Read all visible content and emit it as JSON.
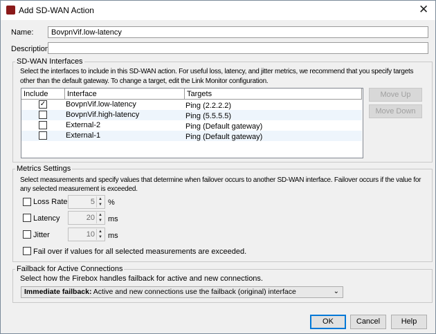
{
  "window": {
    "title": "Add SD-WAN Action"
  },
  "form": {
    "name_label": "Name:",
    "name_value": "BovpnVif.low-latency",
    "description_label": "Description:",
    "description_value": ""
  },
  "interfaces": {
    "legend": "SD-WAN Interfaces",
    "help_line1": "Select the interfaces to include in this SD-WAN action. For useful loss, latency, and jitter metrics, we recommend that you specify targets",
    "help_line2": "other than the default gateway. To change a target, edit the Link Monitor configuration.",
    "columns": [
      "Include",
      "Interface",
      "Targets"
    ],
    "rows": [
      {
        "include": true,
        "interface": "BovpnVif.low-latency",
        "target": "Ping (2.2.2.2)"
      },
      {
        "include": false,
        "interface": "BovpnVif.high-latency",
        "target": "Ping (5.5.5.5)"
      },
      {
        "include": false,
        "interface": "External-2",
        "target": "Ping (Default gateway)"
      },
      {
        "include": false,
        "interface": "External-1",
        "target": "Ping (Default gateway)"
      }
    ],
    "move_up": "Move Up",
    "move_down": "Move Down"
  },
  "metrics": {
    "legend": "Metrics Settings",
    "help_line1": "Select measurements and specify values that determine when failover occurs to another SD-WAN interface. Failover occurs if the value for",
    "help_line2": "any selected measurement is exceeded.",
    "items": [
      {
        "label": "Loss Rate",
        "value": "5",
        "unit": "%",
        "checked": false
      },
      {
        "label": "Latency",
        "value": "20",
        "unit": "ms",
        "checked": false
      },
      {
        "label": "Jitter",
        "value": "10",
        "unit": "ms",
        "checked": false
      }
    ],
    "all_label": "Fail over if values for all selected measurements are exceeded."
  },
  "failback": {
    "legend": "Failback for Active Connections",
    "help": "Select how the Firebox handles failback for active and new connections.",
    "selected_bold": "Immediate failback:",
    "selected_rest": " Active and new connections use the failback (original) interface"
  },
  "buttons": {
    "ok": "OK",
    "cancel": "Cancel",
    "help": "Help"
  }
}
